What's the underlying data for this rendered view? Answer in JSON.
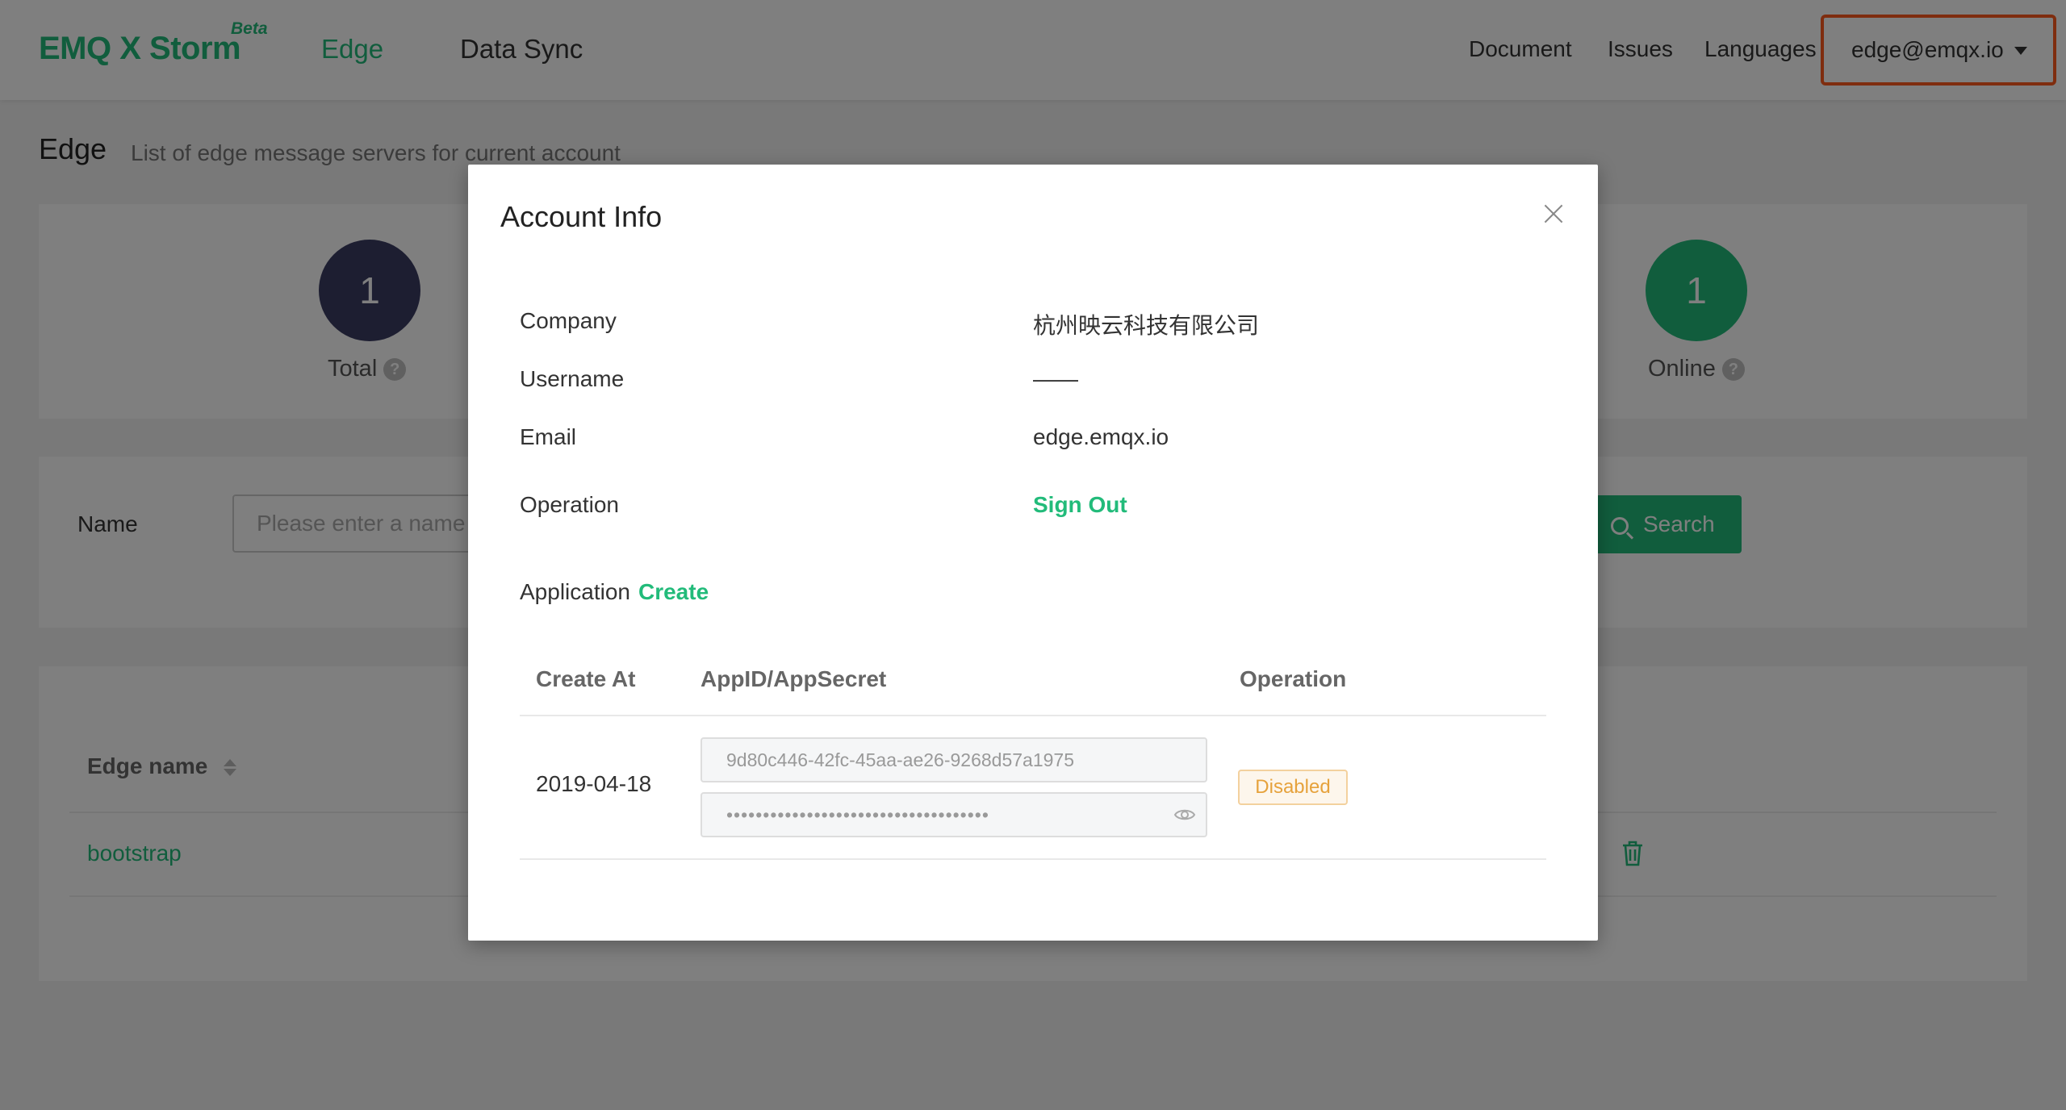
{
  "header": {
    "logo": "EMQ X Storm",
    "logo_badge": "Beta",
    "nav": [
      "Edge",
      "Data Sync"
    ],
    "links": [
      "Document",
      "Issues",
      "Languages"
    ],
    "account": "edge@emqx.io",
    "highlight_color": "#ff5a1f"
  },
  "page": {
    "title": "Edge",
    "description": "List of edge message servers for current account"
  },
  "stats": {
    "total": {
      "value": "1",
      "label": "Total"
    },
    "online": {
      "value": "1",
      "label": "Online"
    }
  },
  "search": {
    "label": "Name",
    "placeholder": "Please enter a name",
    "button": "Search"
  },
  "table": {
    "columns": [
      "Edge name"
    ],
    "rows": [
      {
        "name": "bootstrap"
      }
    ]
  },
  "modal": {
    "title": "Account Info",
    "fields": [
      {
        "label": "Company",
        "value": "杭州映云科技有限公司"
      },
      {
        "label": "Username",
        "value": "——"
      },
      {
        "label": "Email",
        "value": "edge.emqx.io"
      },
      {
        "label": "Operation",
        "value": "Sign Out"
      }
    ],
    "application": {
      "label": "Application",
      "create": "Create",
      "columns": [
        "Create At",
        "AppID/AppSecret",
        "Operation"
      ],
      "rows": [
        {
          "create_at": "2019-04-18",
          "app_id": "9d80c446-42fc-45aa-ae26-9268d57a1975",
          "app_secret": "••••••••••••••••••••••••••••••••••••",
          "status": "Disabled"
        }
      ]
    }
  },
  "colors": {
    "accent": "#22bb7a",
    "total_circle": "#3b3c63",
    "warning": "#e6a23c"
  }
}
